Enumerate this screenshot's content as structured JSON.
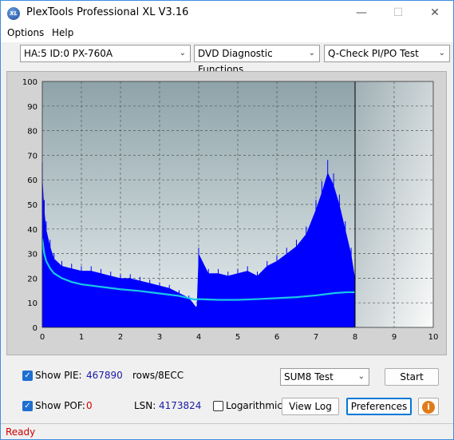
{
  "window": {
    "title": "PlexTools Professional XL V3.16"
  },
  "menu": {
    "options": "Options",
    "help": "Help"
  },
  "toolbar": {
    "drive": "HA:5 ID:0  PX-760A",
    "function": "DVD Diagnostic Functions",
    "test": "Q-Check PI/PO Test"
  },
  "chart_data": {
    "type": "area",
    "xlim": [
      0,
      10
    ],
    "ylim": [
      0,
      100
    ],
    "x_ticks": [
      "0",
      "1",
      "2",
      "3",
      "4",
      "5",
      "6",
      "7",
      "8",
      "9",
      "10"
    ],
    "y_ticks": [
      "0",
      "10",
      "20",
      "30",
      "40",
      "50",
      "60",
      "70",
      "80",
      "90",
      "100"
    ],
    "grid": true,
    "series": [
      {
        "kind": "bars",
        "color": "#0000ff",
        "x": [
          0,
          0.05,
          0.1,
          0.2,
          0.3,
          0.5,
          0.75,
          1.0,
          1.25,
          1.5,
          1.75,
          2.0,
          2.25,
          2.5,
          2.75,
          3.0,
          3.25,
          3.5,
          3.75,
          3.95,
          4.0,
          4.25,
          4.5,
          4.75,
          5.0,
          5.25,
          5.5,
          5.75,
          6.0,
          6.25,
          6.5,
          6.75,
          7.0,
          7.15,
          7.3,
          7.45,
          7.6,
          7.75,
          7.9,
          8.0
        ],
        "y": [
          62,
          48,
          40,
          33,
          28,
          25,
          24,
          23,
          23,
          22,
          21,
          20,
          20,
          19,
          18,
          17,
          16,
          14,
          12,
          8,
          30,
          22,
          22,
          21,
          22,
          23,
          21,
          25,
          27,
          30,
          33,
          38,
          48,
          55,
          63,
          58,
          50,
          40,
          30,
          20
        ]
      },
      {
        "kind": "line",
        "color": "#19c8e6",
        "x": [
          0,
          0.05,
          0.1,
          0.2,
          0.3,
          0.5,
          0.75,
          1.0,
          1.5,
          2.0,
          2.5,
          3.0,
          3.5,
          3.9,
          4.0,
          4.5,
          5.0,
          5.5,
          6.0,
          6.5,
          7.0,
          7.5,
          7.8,
          8.0
        ],
        "y": [
          36,
          30,
          27,
          24,
          22,
          20,
          18.5,
          17.5,
          16.5,
          15.5,
          14.8,
          13.8,
          12.8,
          11.3,
          11.5,
          11.2,
          11.2,
          11.5,
          11.9,
          12.3,
          13,
          14,
          14.3,
          14.3
        ]
      }
    ],
    "marker_x": 8
  },
  "bottom": {
    "show_pie_label": "Show PIE:",
    "pie_value": "467890",
    "pie_unit": "rows/8ECC",
    "show_pof_label": "Show POF:",
    "pof_value": "0",
    "lsn_label": "LSN:",
    "lsn_value": "4173824",
    "logarithmic_label": "Logarithmic",
    "test_select": "SUM8 Test",
    "start": "Start",
    "view_log": "View Log",
    "preferences": "Preferences"
  },
  "status": {
    "text": "Ready"
  },
  "colors": {
    "pie_value": "#1a1aa6",
    "pof_value": "#d00000",
    "status": "#d00000"
  }
}
